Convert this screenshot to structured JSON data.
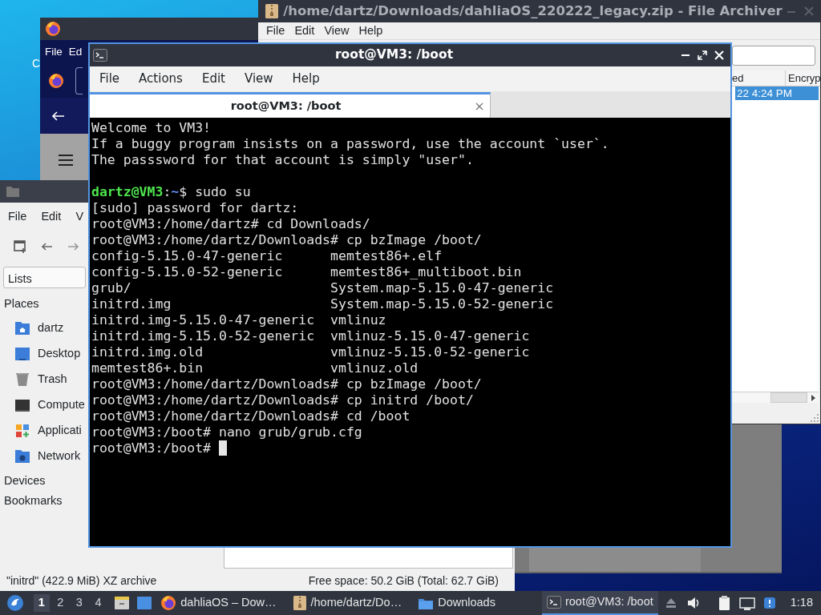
{
  "desktop": {
    "icon_label": "C"
  },
  "browser_window": {
    "menu": [
      "File",
      "Ed"
    ]
  },
  "archiver_window": {
    "title": "/home/dartz/Downloads/dahliaOS_220222_legacy.zip - File Archiver",
    "menu": [
      "File",
      "Edit",
      "View",
      "Help"
    ],
    "columns": [
      "ed",
      "Encryp"
    ],
    "rows": [
      {
        "cells": [
          "22 4:24 PM"
        ],
        "selected": true
      }
    ]
  },
  "file_manager": {
    "menu": [
      "File",
      "Edit",
      "V"
    ],
    "side_pane_mode": "Lists",
    "places_heading": "Places",
    "places": [
      {
        "label": "dartz",
        "kind": "home"
      },
      {
        "label": "Desktop",
        "kind": "desktop"
      },
      {
        "label": "Trash",
        "kind": "trash"
      },
      {
        "label": "Compute",
        "kind": "computer"
      },
      {
        "label": "Applicati",
        "kind": "applications"
      },
      {
        "label": "Network",
        "kind": "network"
      }
    ],
    "sections": [
      "Devices",
      "Bookmarks"
    ],
    "status_left": "\"initrd\" (422.9 MiB) XZ archive",
    "status_right": "Free space: 50.2 GiB (Total: 62.7 GiB)"
  },
  "terminal": {
    "title": "root@VM3: /boot",
    "menu": [
      "File",
      "Actions",
      "Edit",
      "View",
      "Help"
    ],
    "tabs": [
      {
        "label": "root@VM3: /boot",
        "selected": true
      }
    ],
    "lines": [
      {
        "kind": "text",
        "text": "Welcome to VM3!"
      },
      {
        "kind": "text",
        "text": "If a buggy program insists on a password, use the account `user`."
      },
      {
        "kind": "text",
        "text": "The passsword for that account is simply \"user\"."
      },
      {
        "kind": "blank"
      },
      {
        "kind": "prompt",
        "segments": [
          {
            "text": "dartz@VM3",
            "color": "#4ee44e"
          },
          {
            "text": ":",
            "color": "#e0e0e0"
          },
          {
            "text": "~",
            "color": "#5c8ef2"
          },
          {
            "text": "$ sudo su",
            "color": "#e0e0e0"
          }
        ]
      },
      {
        "kind": "text",
        "text": "[sudo] password for dartz:"
      },
      {
        "kind": "text",
        "text": "root@VM3:/home/dartz# cd Downloads/"
      },
      {
        "kind": "text",
        "text": "root@VM3:/home/dartz/Downloads# cp bzImage /boot/"
      },
      {
        "kind": "text",
        "text": "config-5.15.0-47-generic      memtest86+.elf"
      },
      {
        "kind": "text",
        "text": "config-5.15.0-52-generic      memtest86+_multiboot.bin"
      },
      {
        "kind": "text",
        "text": "grub/                         System.map-5.15.0-47-generic"
      },
      {
        "kind": "text",
        "text": "initrd.img                    System.map-5.15.0-52-generic"
      },
      {
        "kind": "text",
        "text": "initrd.img-5.15.0-47-generic  vmlinuz"
      },
      {
        "kind": "text",
        "text": "initrd.img-5.15.0-52-generic  vmlinuz-5.15.0-47-generic"
      },
      {
        "kind": "text",
        "text": "initrd.img.old                vmlinuz-5.15.0-52-generic"
      },
      {
        "kind": "text",
        "text": "memtest86+.bin                vmlinuz.old"
      },
      {
        "kind": "text",
        "text": "root@VM3:/home/dartz/Downloads# cp bzImage /boot/"
      },
      {
        "kind": "text",
        "text": "root@VM3:/home/dartz/Downloads# cp initrd /boot/"
      },
      {
        "kind": "text",
        "text": "root@VM3:/home/dartz/Downloads# cd /boot"
      },
      {
        "kind": "text",
        "text": "root@VM3:/boot# nano grub/grub.cfg"
      },
      {
        "kind": "text",
        "text": "root@VM3:/boot#"
      }
    ]
  },
  "taskbar": {
    "workspaces": [
      {
        "label": "1",
        "selected": true
      },
      {
        "label": "2",
        "selected": false
      },
      {
        "label": "3",
        "selected": false
      },
      {
        "label": "4",
        "selected": false
      }
    ],
    "tasks": [
      {
        "label": "dahliaOS – Dow…",
        "kind": "browser",
        "selected": false
      },
      {
        "label": "/home/dartz/Do…",
        "kind": "archiver",
        "selected": false
      },
      {
        "label": "Downloads",
        "kind": "folder",
        "selected": false
      },
      {
        "label": "root@VM3: /boot",
        "kind": "terminal",
        "selected": true
      }
    ],
    "clock": "1:18"
  }
}
